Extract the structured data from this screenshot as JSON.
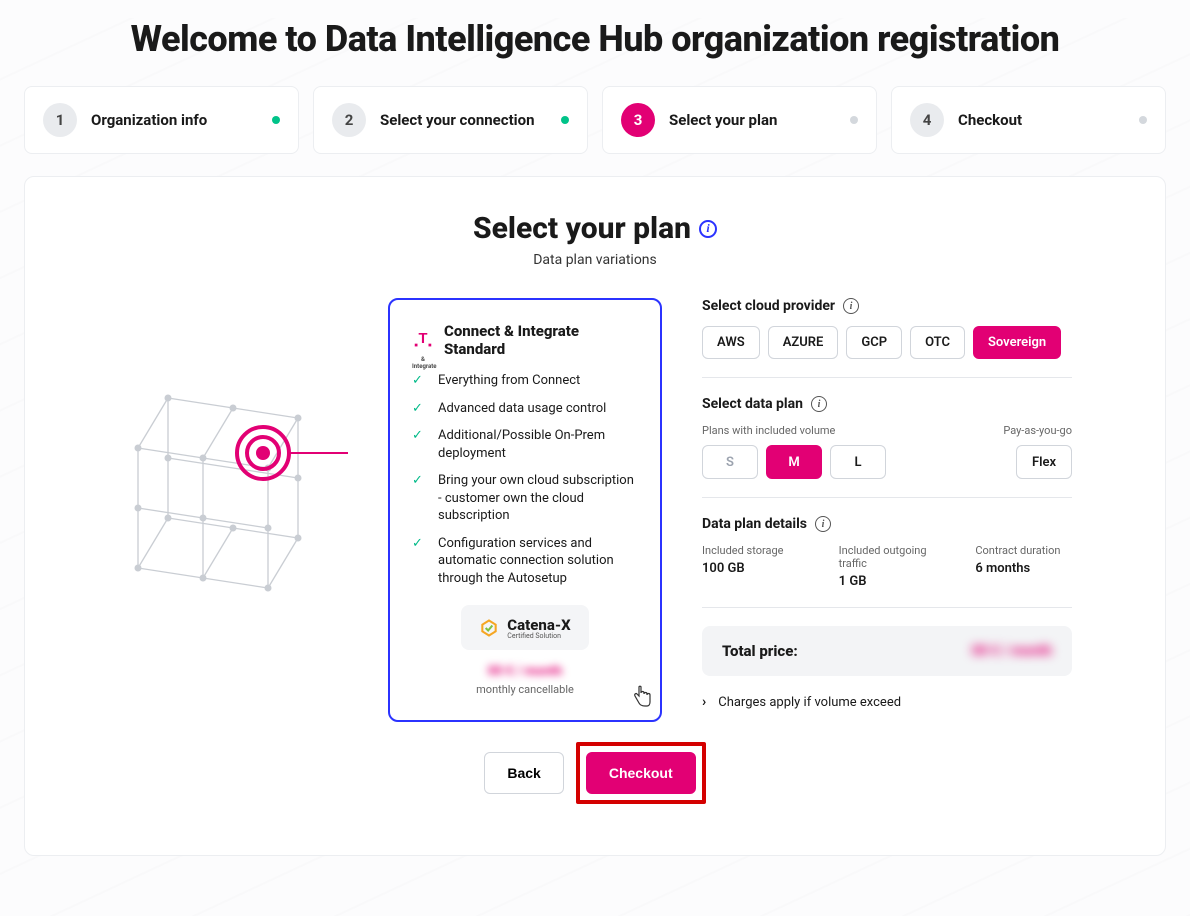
{
  "page_title": "Welcome to Data Intelligence Hub organization registration",
  "stepper": [
    {
      "num": "1",
      "label": "Organization info",
      "done": true,
      "active": false
    },
    {
      "num": "2",
      "label": "Select your connection",
      "done": true,
      "active": false
    },
    {
      "num": "3",
      "label": "Select your plan",
      "done": false,
      "active": true
    },
    {
      "num": "4",
      "label": "Checkout",
      "done": false,
      "active": false
    }
  ],
  "section": {
    "title": "Select your plan",
    "subtitle": "Data plan variations"
  },
  "plan_card": {
    "title": "Connect & Integrate Standard",
    "logo_sub": "& Integrate",
    "features": [
      "Everything from Connect",
      "Advanced data usage control",
      "Additional/Possible On-Prem deployment",
      "Bring your own cloud subscription - customer own the cloud subscription",
      "Configuration services and automatic connection solution through the Autosetup"
    ],
    "catena_name": "Catena-X",
    "catena_sub": "Certified Solution",
    "price_blurred": "00 € / month",
    "price_note": "monthly cancellable"
  },
  "config": {
    "cloud_label": "Select cloud provider",
    "providers": [
      "AWS",
      "AZURE",
      "GCP",
      "OTC",
      "Sovereign"
    ],
    "provider_selected": "Sovereign",
    "plan_label": "Select data plan",
    "plan_hint_left": "Plans with included volume",
    "plan_hint_right": "Pay-as-you-go",
    "sizes": [
      "S",
      "M",
      "L"
    ],
    "size_selected": "M",
    "size_disabled": "S",
    "flex_label": "Flex",
    "details_label": "Data plan details",
    "details": [
      {
        "label": "Included storage",
        "value": "100 GB"
      },
      {
        "label": "Included outgoing traffic",
        "value": "1 GB"
      },
      {
        "label": "Contract duration",
        "value": "6 months"
      }
    ],
    "total_label": "Total price:",
    "total_value_blurred": "00 € / month",
    "charges_note": "Charges apply if volume exceed"
  },
  "buttons": {
    "back": "Back",
    "checkout": "Checkout"
  }
}
